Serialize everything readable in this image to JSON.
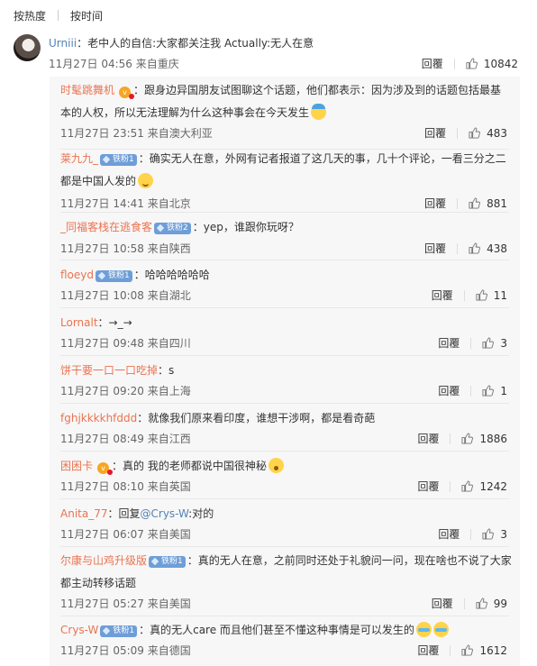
{
  "sort": {
    "hot": "按热度",
    "time": "按时间"
  },
  "top_comment": {
    "user": "Urniii",
    "text": "：老中人的自信:大家都关注我 Actually:无人在意",
    "date": "11月27日 04:56 来自重庆",
    "reply_label": "回覆",
    "likes": "10842"
  },
  "replies": [
    {
      "user": "时髦跳舞机",
      "vip": "v",
      "text1": "：跟身边异国朋友试图聊这个话题，他们都表示：因为涉及到的话题包括最基",
      "text2": "本的人权，所以无法理解为什么这种事会在今天发生",
      "emoji": "hat-emoji",
      "date": "11月27日 23:51 来自澳大利亚",
      "reply_label": "回覆",
      "likes": "483"
    },
    {
      "user": "莱九九_",
      "badge": "铁粉1",
      "text1": "：确实无人在意，外网有记者报道了这几天的事，几十个评论，一看三分之二",
      "text2": "都是中国人发的",
      "emoji": "smile-emoji",
      "date": "11月27日 14:41 来自北京",
      "reply_label": "回覆",
      "likes": "881"
    },
    {
      "user": "_同福客栈在逃食客",
      "badge": "铁粉2",
      "text1": "：yep，谁跟你玩呀？",
      "date": "11月27日 10:58 来自陕西",
      "reply_label": "回覆",
      "likes": "438"
    },
    {
      "user": "floeyd",
      "badge": "铁粉1",
      "text1": "：哈哈哈哈哈哈",
      "date": "11月27日 10:08 来自湖北",
      "reply_label": "回覆",
      "likes": "11"
    },
    {
      "user": "Lornalt",
      "text1": "：→_→",
      "date": "11月27日 09:48 来自四川",
      "reply_label": "回覆",
      "likes": "3"
    },
    {
      "user": "饼干要一口一口吃掉",
      "text1": "：s",
      "date": "11月27日 09:20 来自上海",
      "reply_label": "回覆",
      "likes": "1"
    },
    {
      "user": "fghjkkkkhfddd",
      "text1": "：就像我们原来看印度，谁想干涉啊，都是看奇葩",
      "date": "11月27日 08:49 来自江西",
      "reply_label": "回覆",
      "likes": "1886"
    },
    {
      "user": "困困卡",
      "vip": "v",
      "text1": "：真的 我的老师都说中国很神秘",
      "emoji": "surprise-emoji",
      "date": "11月27日 08:10 来自英国",
      "reply_label": "回覆",
      "likes": "1242"
    },
    {
      "user": "Anita_77",
      "text1": "：回复",
      "mention": "@Crys-W",
      "text1b": ":对的",
      "date": "11月27日 06:07 来自美国",
      "reply_label": "回覆",
      "likes": "3"
    },
    {
      "user": "尔康与山鸡升级版",
      "badge": "铁粉1",
      "text1": "：真的无人在意，之前同时还处于礼貌问一问，现在啥也不说了大家",
      "text2": "都主动转移话题",
      "date": "11月27日 05:27 来自美国",
      "reply_label": "回覆",
      "likes": "99"
    },
    {
      "user": "Crys-W",
      "badge": "铁粉1",
      "text1": "：真的无人care 而且他们甚至不懂这种事情是可以发生的",
      "emoji": "cry-emoji",
      "emoji2": "cry-emoji",
      "date": "11月27日 05:09 来自德国",
      "reply_label": "回覆",
      "likes": "1612"
    }
  ],
  "colors": {
    "username": "#eb7350",
    "badge": "#6e9ed8",
    "reply_bg": "#f7f7f7"
  }
}
